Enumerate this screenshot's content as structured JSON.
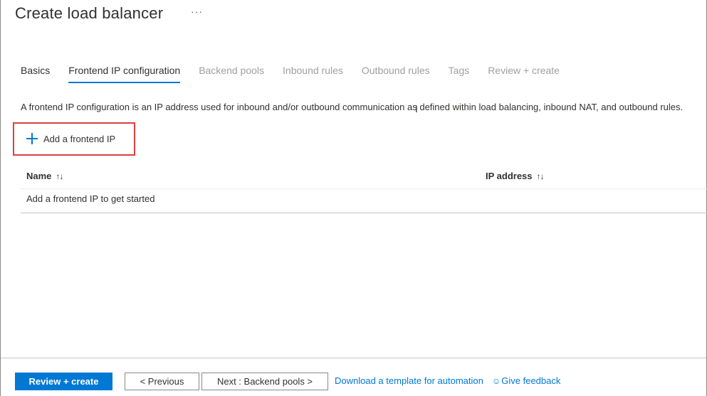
{
  "header": {
    "title": "Create load balancer",
    "more": "···"
  },
  "tabs": [
    {
      "label": "Basics",
      "state": "enabled"
    },
    {
      "label": "Frontend IP configuration",
      "state": "active"
    },
    {
      "label": "Backend pools",
      "state": "disabled"
    },
    {
      "label": "Inbound rules",
      "state": "disabled"
    },
    {
      "label": "Outbound rules",
      "state": "disabled"
    },
    {
      "label": "Tags",
      "state": "disabled"
    },
    {
      "label": "Review + create",
      "state": "disabled"
    }
  ],
  "description": "A frontend IP configuration is an IP address used for inbound and/or outbound communication as defined within load balancing, inbound NAT, and outbound rules.",
  "add_button": {
    "label": "Add a frontend IP",
    "icon": "plus-icon"
  },
  "grid": {
    "columns": [
      {
        "label": "Name",
        "sort_icon": "↑↓"
      },
      {
        "label": "IP address",
        "sort_icon": "↑↓"
      }
    ],
    "empty_text": "Add a frontend IP to get started"
  },
  "footer": {
    "review_create": "Review + create",
    "previous": "< Previous",
    "next": "Next : Backend pools >",
    "download_template": "Download a template for automation",
    "give_feedback": "Give feedback"
  },
  "colors": {
    "accent": "#0078d4",
    "highlight_box": "#e03e3e",
    "disabled_text": "#a19f9d"
  }
}
